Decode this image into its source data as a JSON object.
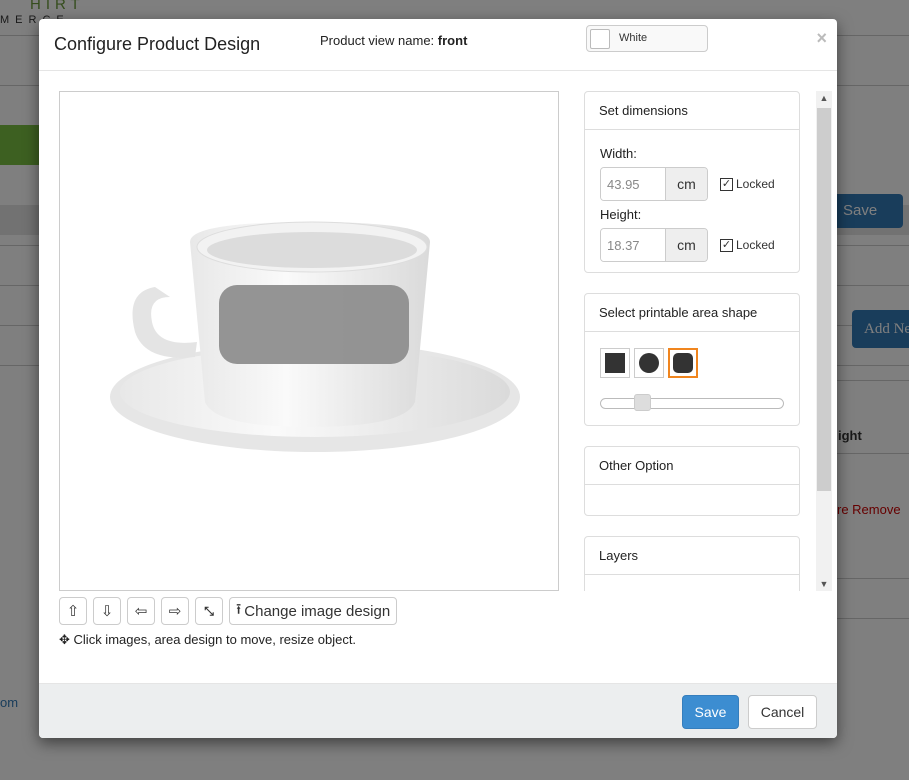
{
  "background": {
    "logo_top": "HIRT",
    "logo_bottom": "MERCE",
    "save_label": "Save",
    "add_label": "Add Ne",
    "col_label": "ight",
    "remove_text": "re Remove",
    "link_text": "om"
  },
  "modal": {
    "title": "Configure Product Design",
    "view_name_label": "Product view name:",
    "view_name": "front",
    "color_select": {
      "value": "White",
      "swatch_color": "#ffffff"
    },
    "close_icon": "close-icon",
    "toolbar": {
      "change_image_label": "Change image design",
      "icons": [
        "arrow-up-icon",
        "arrow-down-icon",
        "arrow-left-icon",
        "arrow-right-icon",
        "compress-icon",
        "upload-icon"
      ]
    },
    "hint": "Click images, area design to move, resize object.",
    "dimensions": {
      "title": "Set dimensions",
      "width_label": "Width:",
      "width_value": "43.95",
      "height_label": "Height:",
      "height_value": "18.37",
      "unit": "cm",
      "locked_label": "Locked",
      "width_locked": true,
      "height_locked": true
    },
    "shape": {
      "title": "Select printable area shape",
      "options": [
        "square",
        "circle",
        "rounded-square"
      ],
      "selected": "rounded-square",
      "selected_color": "#f0851e",
      "slider_percent": 20
    },
    "other": {
      "title": "Other Option"
    },
    "layers": {
      "title": "Layers"
    },
    "footer": {
      "save": "Save",
      "cancel": "Cancel",
      "save_color": "#3c8dd1"
    }
  }
}
